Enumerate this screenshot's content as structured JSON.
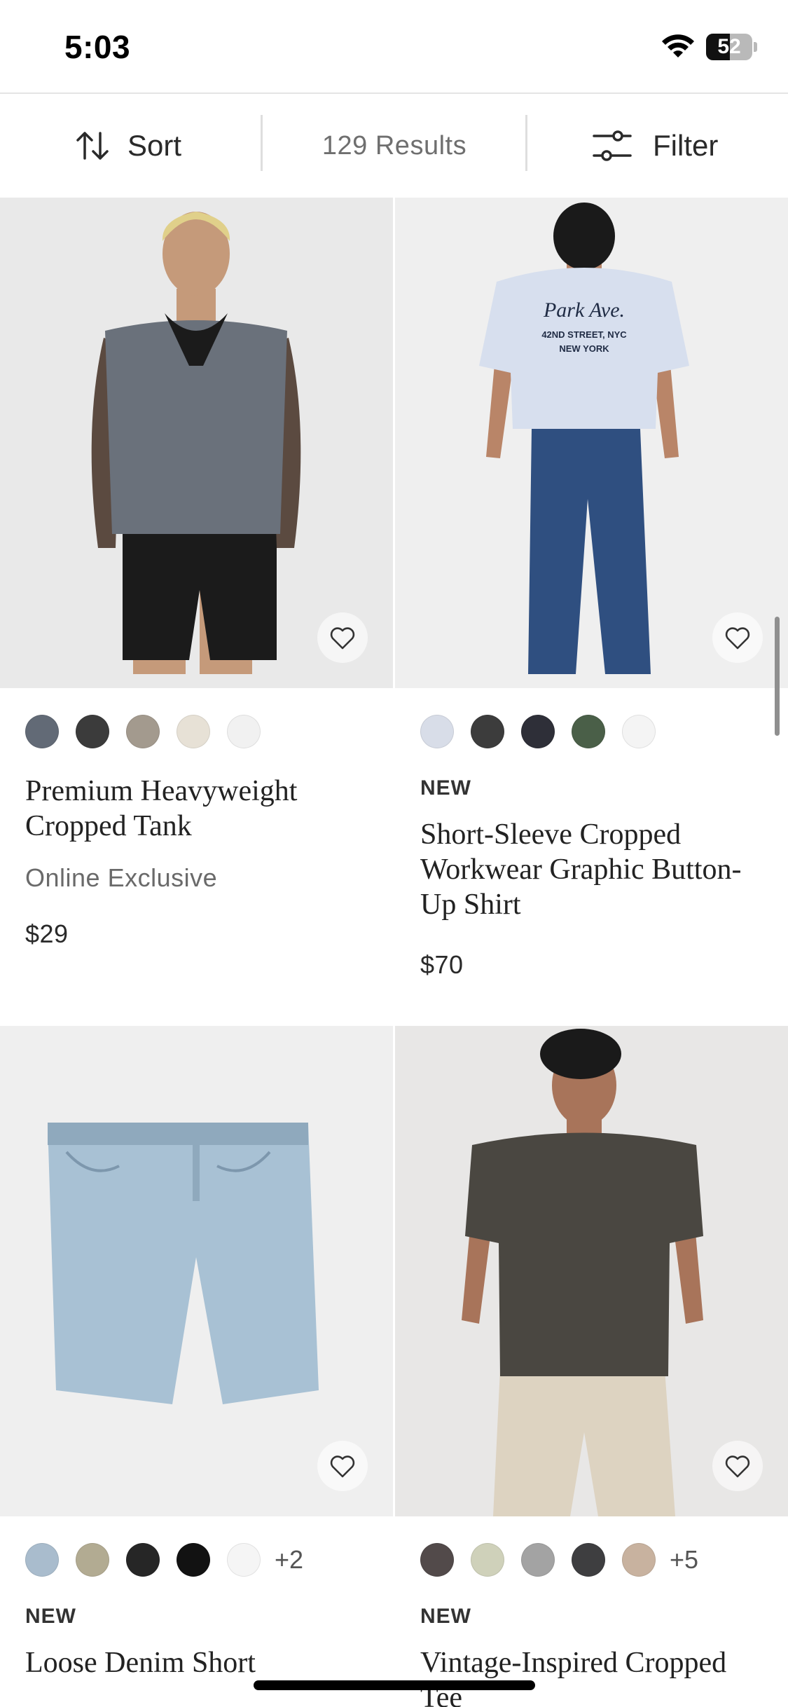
{
  "status_bar": {
    "time": "5:03",
    "battery_level": "52",
    "battery_fraction": 0.52
  },
  "toolbar": {
    "sort_label": "Sort",
    "results": "129 Results",
    "filter_label": "Filter"
  },
  "products": [
    {
      "title": "Premium Heavyweight Cropped Tank",
      "badge": "",
      "note": "Online Exclusive",
      "price": "$29",
      "more_colors": "",
      "swatch_colors": [
        "#626a76",
        "#3b3b3b",
        "#a39a8e",
        "#e7e1d6",
        "#f1f1f1"
      ],
      "image_palette": {
        "bg": "#e9e9e9",
        "garment": "#6a717b",
        "bottom": "#1b1b1b",
        "skin": "#c59a7a"
      }
    },
    {
      "title": "Short-Sleeve Cropped Workwear Graphic Button-Up Shirt",
      "badge": "NEW",
      "note": "",
      "price": "$70",
      "more_colors": "",
      "swatch_colors": [
        "#d8dde8",
        "#3c3c3c",
        "#2e2f38",
        "#4a5f48",
        "#f4f4f4"
      ],
      "image_palette": {
        "bg": "#efefef",
        "garment": "#d7dfee",
        "bottom": "#2f4f80",
        "skin": "#b98568"
      }
    },
    {
      "title": "Loose Denim Short",
      "badge": "NEW",
      "note": "",
      "price": "",
      "more_colors": "+2",
      "swatch_colors": [
        "#a9bccd",
        "#b2ab92",
        "#262626",
        "#121212",
        "#f5f5f5"
      ],
      "image_palette": {
        "bg": "#efefef",
        "garment": "#a8c1d4",
        "bottom": "#8fa9bd",
        "skin": ""
      }
    },
    {
      "title": "Vintage-Inspired Cropped Tee",
      "badge": "NEW",
      "note": "",
      "price": "",
      "more_colors": "+5",
      "swatch_colors": [
        "#524a4a",
        "#cfd1ba",
        "#a3a3a3",
        "#3e3e40",
        "#c8b29f"
      ],
      "image_palette": {
        "bg": "#e8e7e6",
        "garment": "#4a4741",
        "bottom": "#ddd3c1",
        "skin": "#a8745a"
      }
    }
  ]
}
